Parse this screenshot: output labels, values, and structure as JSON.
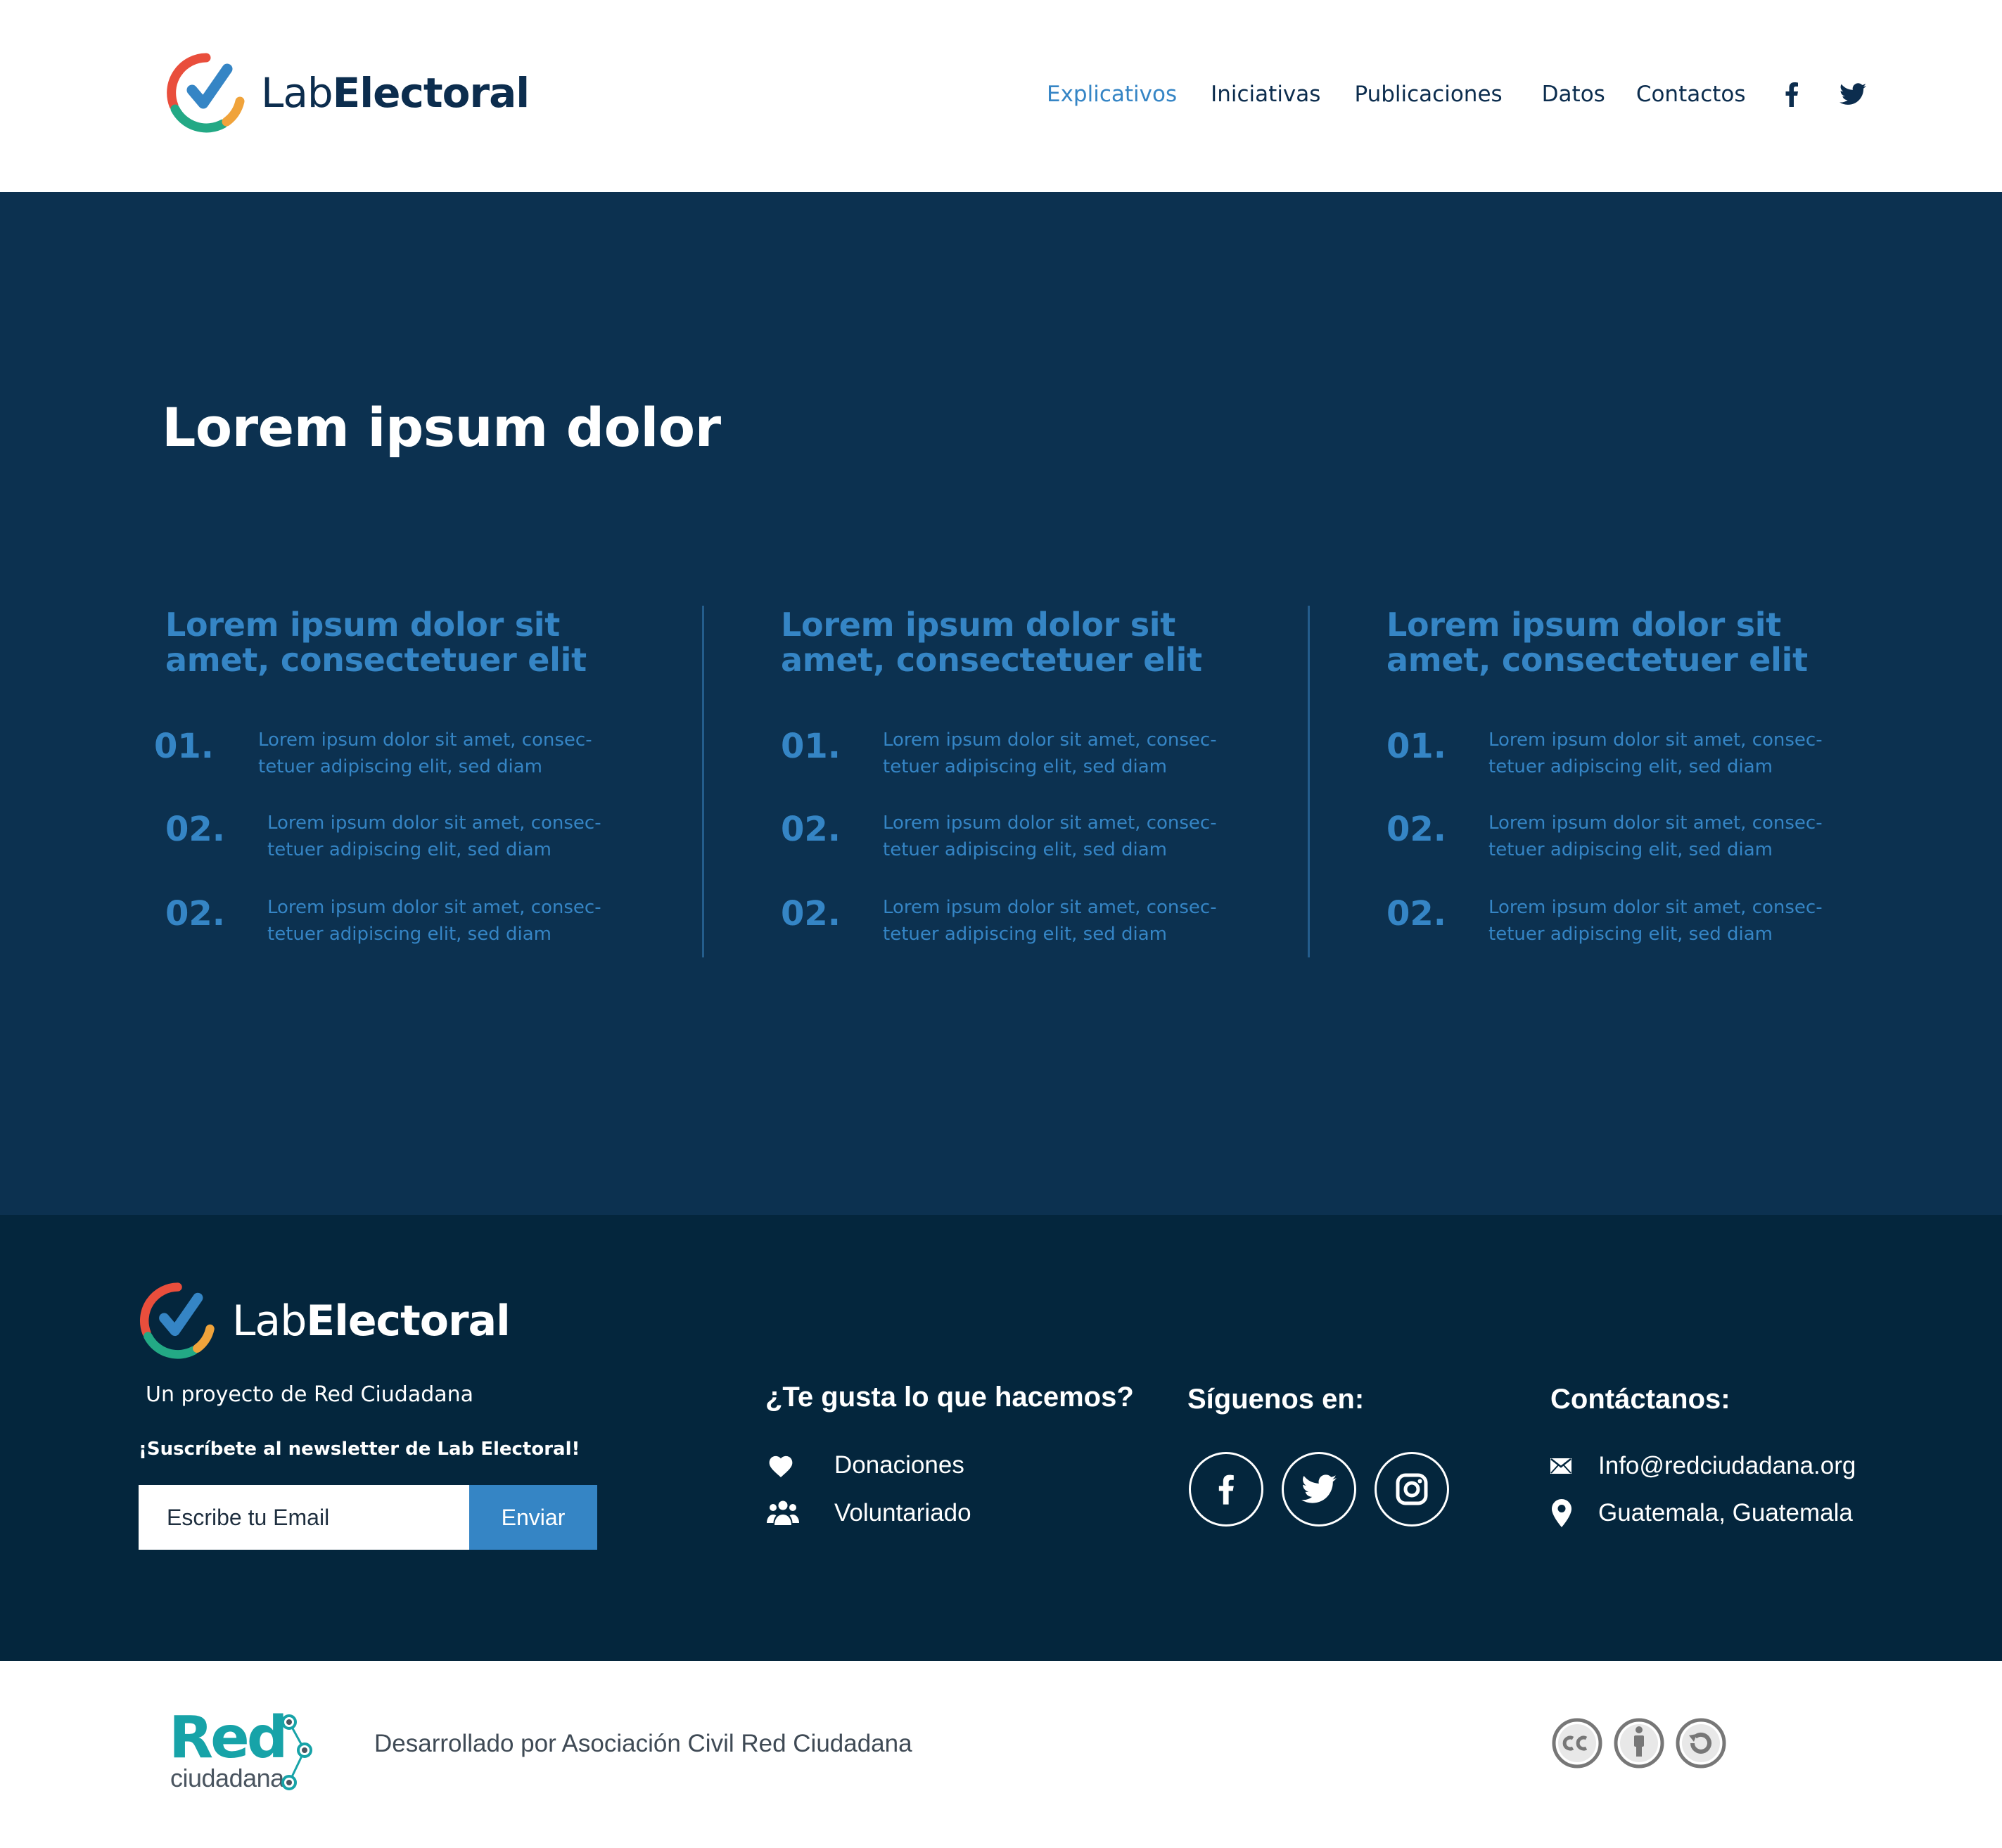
{
  "brand": {
    "name_light": "Lab",
    "name_bold": "Electoral"
  },
  "nav": {
    "items": [
      {
        "label": "Explicativos",
        "active": true
      },
      {
        "label": "Iniciativas",
        "active": false
      },
      {
        "label": "Publicaciones",
        "active": false
      },
      {
        "label": "Datos",
        "active": false
      },
      {
        "label": "Contactos",
        "active": false
      }
    ],
    "icons": [
      "facebook-icon",
      "twitter-icon"
    ]
  },
  "hero": {
    "title": "Lorem ipsum dolor",
    "columns": [
      {
        "title": "Lorem ipsum dolor sit amet, consectetuer elit",
        "items": [
          {
            "num": "01.",
            "text": "Lorem ipsum dolor sit amet, consec-tetuer adipiscing elit, sed diam"
          },
          {
            "num": "02.",
            "text": "Lorem ipsum dolor sit amet, consec-tetuer adipiscing elit, sed diam"
          },
          {
            "num": "02.",
            "text": "Lorem ipsum dolor sit amet, consec-tetuer adipiscing elit, sed diam"
          }
        ]
      },
      {
        "title": "Lorem ipsum dolor sit amet, consectetuer elit",
        "items": [
          {
            "num": "01.",
            "text": "Lorem ipsum dolor sit amet, consec-tetuer adipiscing elit, sed diam"
          },
          {
            "num": "02.",
            "text": "Lorem ipsum dolor sit amet, consec-tetuer adipiscing elit, sed diam"
          },
          {
            "num": "02.",
            "text": "Lorem ipsum dolor sit amet, consec-tetuer adipiscing elit, sed diam"
          }
        ]
      },
      {
        "title": "Lorem ipsum dolor sit amet, consectetuer elit",
        "items": [
          {
            "num": "01.",
            "text": "Lorem ipsum dolor sit amet, consec-tetuer adipiscing elit, sed diam"
          },
          {
            "num": "02.",
            "text": "Lorem ipsum dolor sit amet, consec-tetuer adipiscing elit, sed diam"
          },
          {
            "num": "02.",
            "text": "Lorem ipsum dolor sit amet, consec-tetuer adipiscing elit, sed diam"
          }
        ]
      }
    ]
  },
  "footer": {
    "subtitle": "Un proyecto de Red Ciudadana",
    "newsletter_label": "¡Suscríbete al newsletter de Lab Electoral!",
    "email_placeholder": "Escribe tu Email",
    "send_label": "Enviar",
    "support": {
      "heading": "¿Te gusta lo que hacemos?",
      "items": [
        {
          "icon": "heart-icon",
          "label": "Donaciones"
        },
        {
          "icon": "users-icon",
          "label": "Voluntariado"
        }
      ]
    },
    "follow": {
      "heading": "Síguenos en:",
      "icons": [
        "facebook-icon",
        "twitter-icon",
        "instagram-icon"
      ]
    },
    "contact": {
      "heading": "Contáctanos:",
      "items": [
        {
          "icon": "mail-icon",
          "label": "Info@redciudadana.org"
        },
        {
          "icon": "location-pin-icon",
          "label": "Guatemala, Guatemala"
        }
      ]
    }
  },
  "bottom": {
    "org_logo_top": "Red",
    "org_logo_bottom": "ciudadana",
    "credit": "Desarrollado por Asociación Civil Red Ciudadana",
    "license_icons": [
      "creative-commons-icon",
      "attribution-icon",
      "share-alike-icon"
    ]
  },
  "colors": {
    "navy": "#0c2d4e",
    "hero_bg": "#0c3150",
    "footer_bg": "#04263d",
    "accent_blue": "#3585c5",
    "teal": "#17a3a8"
  }
}
